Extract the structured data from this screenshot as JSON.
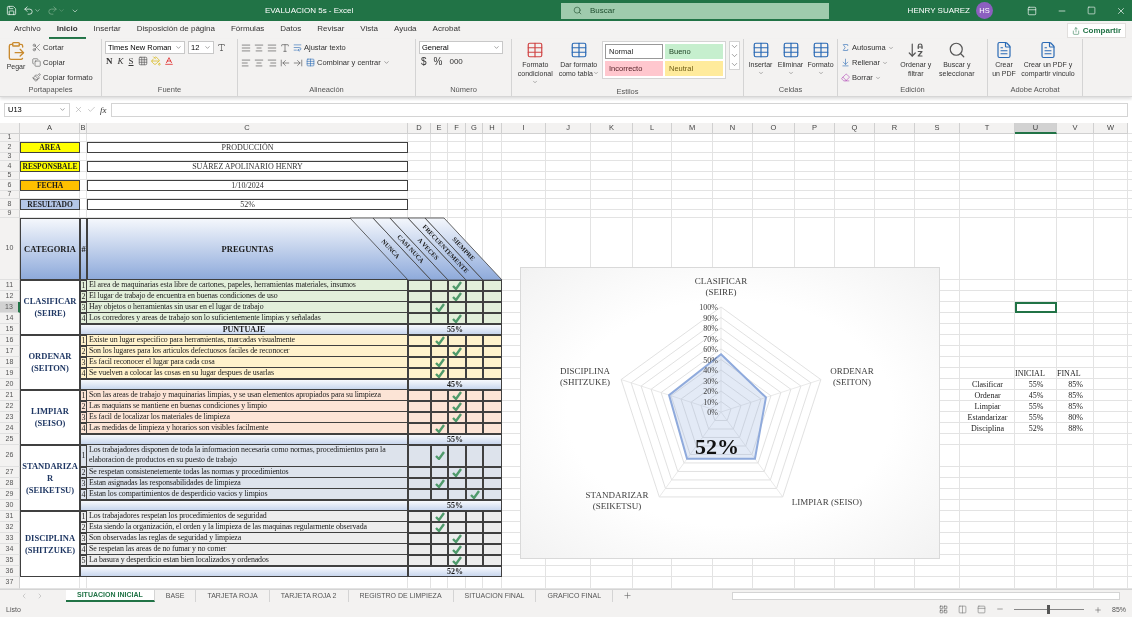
{
  "window": {
    "title": "EVALUACION 5s  -  Excel",
    "search_placeholder": "Buscar",
    "user": "HENRY SUAREZ",
    "avatar": "HS"
  },
  "menu": [
    {
      "label": "Archivo",
      "selected": false
    },
    {
      "label": "Inicio",
      "selected": true
    },
    {
      "label": "Insertar",
      "selected": false
    },
    {
      "label": "Disposición de página",
      "selected": false
    },
    {
      "label": "Fórmulas",
      "selected": false
    },
    {
      "label": "Datos",
      "selected": false
    },
    {
      "label": "Revisar",
      "selected": false
    },
    {
      "label": "Vista",
      "selected": false
    },
    {
      "label": "Ayuda",
      "selected": false
    },
    {
      "label": "Acrobat",
      "selected": false
    }
  ],
  "share": "Compartir",
  "ribbon": [
    {
      "kind": "clipboard",
      "label": "Portapapeles",
      "paste": "Pegar",
      "actions": [
        "Cortar",
        "Copiar",
        "Copiar formato"
      ]
    },
    {
      "kind": "font",
      "label": "Fuente",
      "font": "Times New Roman",
      "size": "12",
      "styles": [
        "N",
        "K",
        "S"
      ]
    },
    {
      "kind": "alignment",
      "label": "Alineación",
      "actions": [
        "Ajustar texto",
        "Combinar y centrar"
      ]
    },
    {
      "kind": "number",
      "label": "Número",
      "format": "General",
      "symbols": [
        "$",
        "%",
        "000"
      ]
    },
    {
      "kind": "styles",
      "label": "Estilos",
      "actions": [
        "Formato condicional",
        "Dar formato como tabla"
      ],
      "cell_styles": [
        {
          "label": "Normal",
          "color": "#ffffff"
        },
        {
          "label": "Bueno",
          "color": "#c6efce"
        },
        {
          "label": "Incorrecto",
          "color": "#ffc7ce"
        },
        {
          "label": "Neutral",
          "color": "#ffeb9c"
        }
      ]
    },
    {
      "kind": "cells",
      "label": "Celdas",
      "actions": [
        "Insertar",
        "Eliminar",
        "Formato"
      ]
    },
    {
      "kind": "editing",
      "label": "Edición",
      "small": [
        "Autosuma",
        "Rellenar",
        "Borrar"
      ],
      "actions": [
        "Ordenar y filtrar",
        "Buscar y seleccionar"
      ]
    },
    {
      "kind": "acrobat",
      "label": "Adobe Acrobat",
      "actions": [
        "Crear un PDF",
        "Crear un PDF y compartir vínculo"
      ]
    }
  ],
  "formula_bar": {
    "name_box": "U13",
    "function_label": "fx"
  },
  "columns": [
    {
      "label": "A",
      "selected": false
    },
    {
      "label": "B",
      "selected": false
    },
    {
      "label": "C",
      "selected": false
    },
    {
      "label": "D",
      "selected": false
    },
    {
      "label": "E",
      "selected": false
    },
    {
      "label": "F",
      "selected": false
    },
    {
      "label": "G",
      "selected": false
    },
    {
      "label": "H",
      "selected": false
    },
    {
      "label": "I",
      "selected": false
    },
    {
      "label": "J",
      "selected": false
    },
    {
      "label": "K",
      "selected": false
    },
    {
      "label": "L",
      "selected": false
    },
    {
      "label": "M",
      "selected": false
    },
    {
      "label": "N",
      "selected": false
    },
    {
      "label": "O",
      "selected": false
    },
    {
      "label": "P",
      "selected": false
    },
    {
      "label": "Q",
      "selected": false
    },
    {
      "label": "R",
      "selected": false
    },
    {
      "label": "S",
      "selected": false
    },
    {
      "label": "T",
      "selected": false
    },
    {
      "label": "U",
      "selected": true
    },
    {
      "label": "V",
      "selected": false
    },
    {
      "label": "W",
      "selected": false
    }
  ],
  "rows": [
    {
      "label": "1",
      "selected": false
    },
    {
      "label": "2",
      "selected": false
    },
    {
      "label": "3",
      "selected": false
    },
    {
      "label": "4",
      "selected": false
    },
    {
      "label": "5",
      "selected": false
    },
    {
      "label": "6",
      "selected": false
    },
    {
      "label": "7",
      "selected": false
    },
    {
      "label": "8",
      "selected": false
    },
    {
      "label": "9",
      "selected": false
    },
    {
      "label": "10",
      "selected": false
    },
    {
      "label": "11",
      "selected": false
    },
    {
      "label": "12",
      "selected": false
    },
    {
      "label": "13",
      "selected": true
    },
    {
      "label": "14",
      "selected": false
    },
    {
      "label": "15",
      "selected": false
    },
    {
      "label": "16",
      "selected": false
    },
    {
      "label": "17",
      "selected": false
    },
    {
      "label": "18",
      "selected": false
    },
    {
      "label": "19",
      "selected": false
    },
    {
      "label": "20",
      "selected": false
    },
    {
      "label": "21",
      "selected": false
    },
    {
      "label": "22",
      "selected": false
    },
    {
      "label": "23",
      "selected": false
    },
    {
      "label": "24",
      "selected": false
    },
    {
      "label": "25",
      "selected": false
    },
    {
      "label": "26",
      "selected": false
    },
    {
      "label": "27",
      "selected": false
    },
    {
      "label": "28",
      "selected": false
    },
    {
      "label": "29",
      "selected": false
    },
    {
      "label": "30",
      "selected": false
    },
    {
      "label": "31",
      "selected": false
    },
    {
      "label": "32",
      "selected": false
    },
    {
      "label": "33",
      "selected": false
    },
    {
      "label": "34",
      "selected": false
    },
    {
      "label": "35",
      "selected": false
    },
    {
      "label": "36",
      "selected": false
    },
    {
      "label": "37",
      "selected": false
    }
  ],
  "info": [
    {
      "label": "AREA",
      "value": "PRODUCCIÓN",
      "color": "#ffff00"
    },
    {
      "label": "RESPONSBALE",
      "value": "SUÁREZ APOLINARIO HENRY",
      "color": "#ffff00"
    },
    {
      "label": "FECHA",
      "value": "1/10/2024",
      "color": "#ffc000"
    },
    {
      "label": "RESULTADO",
      "value": "52%",
      "color": "#b4c6e7"
    }
  ],
  "table": {
    "headers": [
      "CATEGORIA",
      "#",
      "PREGUNTAS"
    ],
    "ratings": [
      "NUNCA",
      "CASI NUCA",
      "A VECES",
      "FRECUENTEMENTE",
      "SIEMPRE"
    ],
    "categories": [
      {
        "name": "CLASIFICAR (SEIRE)",
        "color": "#e2efda",
        "score_label": "PUNTUAJE",
        "score": "55%",
        "questions": [
          {
            "number": "1",
            "text": "El area de maquinarias esta libre de cartones, papeles, herramientas materiales, insumos",
            "marks": [
              false,
              false,
              true,
              false,
              false
            ]
          },
          {
            "number": "2",
            "text": "El lugar de trabajo de encuentra en buenas condiciones de uso",
            "marks": [
              false,
              false,
              true,
              false,
              false
            ]
          },
          {
            "number": "3",
            "text": "Hay objetos o herramientas sin usar en el lugar de trabajo",
            "marks": [
              false,
              true,
              false,
              false,
              false
            ]
          },
          {
            "number": "4",
            "text": "Los corredores y areas de trabajo son lo suficientemente limpias y señaladas",
            "marks": [
              false,
              false,
              true,
              false,
              false
            ]
          }
        ]
      },
      {
        "name": "ORDENAR (SEITON)",
        "color": "#fff2cc",
        "score": "45%",
        "questions": [
          {
            "number": "1",
            "text": "Existe un lugar especifico para herramientas, marcadas visualmente",
            "marks": [
              false,
              true,
              false,
              false,
              false
            ]
          },
          {
            "number": "2",
            "text": "Son los lugares para los articulos defectuosos faciles de reconocer",
            "marks": [
              false,
              false,
              true,
              false,
              false
            ]
          },
          {
            "number": "3",
            "text": "Es facil reconocer el lugar para cada cosa",
            "marks": [
              false,
              true,
              false,
              false,
              false
            ]
          },
          {
            "number": "4",
            "text": "Se vuelven a colocar las cosas en su lugar despues de usarlas",
            "marks": [
              false,
              true,
              false,
              false,
              false
            ]
          }
        ]
      },
      {
        "name": "LIMPIAR (SEISO)",
        "color": "#fce4d6",
        "score": "55%",
        "questions": [
          {
            "number": "1",
            "text": "Son las areas de trabajo y maquinarias limpias, y se usan elementos apropiados para su limpieza",
            "marks": [
              false,
              false,
              true,
              false,
              false
            ]
          },
          {
            "number": "2",
            "text": "Las maquians se mantiene en buenas condiciones y limpio",
            "marks": [
              false,
              false,
              true,
              false,
              false
            ]
          },
          {
            "number": "3",
            "text": "Es facil de localizar los materiales de limpieza",
            "marks": [
              false,
              false,
              true,
              false,
              false
            ]
          },
          {
            "number": "4",
            "text": "Las medidas de limpieza y horarios son visibles facilmente",
            "marks": [
              false,
              true,
              false,
              false,
              false
            ]
          }
        ]
      },
      {
        "name": "STANDARIZAR (SEIKETSU)",
        "color": "#dde3ec",
        "score": "55%",
        "questions": [
          {
            "number": "1",
            "text": "Los trabajadores disponen de toda la informacion necesaria como normas, procedimientos para la elaboracion de productos en su puesto de trabajo",
            "marks": [
              false,
              true,
              false,
              false,
              false
            ]
          },
          {
            "number": "2",
            "text": "Se respetan consistenetemente todas las normas y procedimientos",
            "marks": [
              false,
              false,
              true,
              false,
              false
            ]
          },
          {
            "number": "3",
            "text": "Estan asignadas las responsabilidades de limpieza",
            "marks": [
              false,
              true,
              false,
              false,
              false
            ]
          },
          {
            "number": "4",
            "text": "Estan los compartimientos de desperdicio vacios y limpios",
            "marks": [
              false,
              false,
              false,
              true,
              false
            ]
          }
        ]
      },
      {
        "name": "DISCIPLINA (SHITZUKE)",
        "color": "#ededed",
        "score": "52%",
        "questions": [
          {
            "number": "1",
            "text": "Los trabajadores respetan los procedimientos de seguridad",
            "marks": [
              false,
              true,
              false,
              false,
              false
            ]
          },
          {
            "number": "2",
            "text": "Esta siendo la organización, el orden y la limpieza de las maquinas regularmente observada",
            "marks": [
              false,
              true,
              false,
              false,
              false
            ]
          },
          {
            "number": "3",
            "text": "Son observadas las reglas de seguridad y limpieza",
            "marks": [
              false,
              false,
              true,
              false,
              false
            ]
          },
          {
            "number": "4",
            "text": "Se respetan las areas de no fumar y no comer",
            "marks": [
              false,
              false,
              true,
              false,
              false
            ]
          },
          {
            "number": "5",
            "text": "La basura y desperdicio estan bien localizados y ordenados",
            "marks": [
              false,
              false,
              true,
              false,
              false
            ]
          }
        ]
      }
    ]
  },
  "chart_data": {
    "type": "radar",
    "categories": [
      "CLASIFICAR (SEIRE)",
      "ORDENAR (SEITON)",
      "LIMPIAR (SEISO)",
      "STANDARIZAR (SEIKETSU)",
      "DISCIPLINA (SHITZUKE)"
    ],
    "series": [
      {
        "color": "#8faadc",
        "values": [
          55,
          45,
          55,
          55,
          52
        ]
      }
    ],
    "ylim": [
      0,
      100
    ],
    "yticks": [
      {
        "value": 0,
        "label": "0%"
      },
      {
        "value": 10,
        "label": "10%"
      },
      {
        "value": 20,
        "label": "20%"
      },
      {
        "value": 30,
        "label": "30%"
      },
      {
        "value": 40,
        "label": "40%"
      },
      {
        "value": 50,
        "label": "50%"
      },
      {
        "value": 60,
        "label": "60%"
      },
      {
        "value": 70,
        "label": "70%"
      },
      {
        "value": 80,
        "label": "80%"
      },
      {
        "value": 90,
        "label": "90%"
      },
      {
        "value": 100,
        "label": "100%"
      }
    ],
    "annotations": [
      {
        "text": "52%"
      }
    ]
  },
  "summary": {
    "headers": [
      "INICIAL",
      "FINAL"
    ],
    "rows": [
      {
        "label": "Clasificar",
        "inicial": "55%",
        "final": "85%"
      },
      {
        "label": "Ordenar",
        "inicial": "45%",
        "final": "85%"
      },
      {
        "label": "Limpiar",
        "inicial": "55%",
        "final": "85%"
      },
      {
        "label": "Estandarizar",
        "inicial": "55%",
        "final": "80%"
      },
      {
        "label": "Disciplina",
        "inicial": "52%",
        "final": "88%"
      }
    ]
  },
  "sheet_tabs": [
    {
      "label": "SITUACION INICIAL",
      "selected": true
    },
    {
      "label": "BASE",
      "selected": false
    },
    {
      "label": "TARJETA ROJA",
      "selected": false
    },
    {
      "label": "TARJETA ROJA 2",
      "selected": false
    },
    {
      "label": "REGISTRO DE LIMPIEZA",
      "selected": false
    },
    {
      "label": "SITUACION FINAL",
      "selected": false
    },
    {
      "label": "GRAFICO FINAL",
      "selected": false
    }
  ],
  "status_bar": {
    "text": "Listo",
    "zoom": {
      "label": "85%",
      "level": 0.47
    }
  }
}
